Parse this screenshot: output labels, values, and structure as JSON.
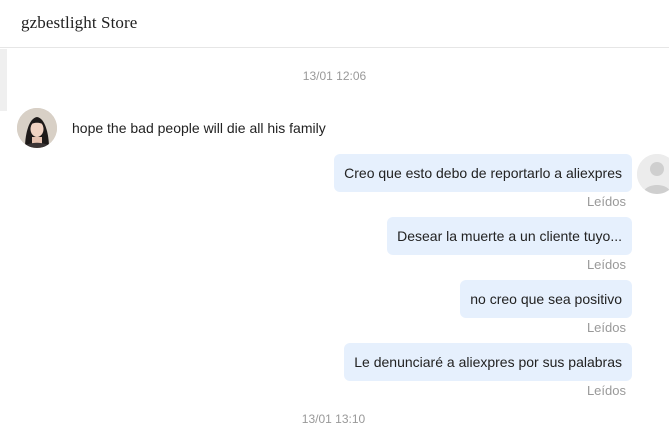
{
  "header": {
    "store_name": "gzbestlight Store"
  },
  "chat": {
    "timestamps": [
      "13/01 12:06",
      "13/01 13:10"
    ],
    "incoming": [
      {
        "text": "hope the bad people will die all his family"
      }
    ],
    "outgoing": [
      {
        "text": "Creo que esto debo de reportarlo a aliexpres",
        "status": "Leídos"
      },
      {
        "text": "Desear la muerte a un cliente tuyo...",
        "status": "Leídos"
      },
      {
        "text": "no creo que sea positivo",
        "status": "Leídos"
      },
      {
        "text": "Le denunciaré a aliexpres por sus palabras",
        "status": "Leídos"
      }
    ]
  },
  "colors": {
    "outgoing_bubble": "#e6f0fd",
    "muted_text": "#999999",
    "primary_text": "#222222",
    "header_border": "#e6e6e6"
  },
  "icons": {
    "seller_avatar": "seller-avatar-photo",
    "user_avatar": "default-user-avatar-icon"
  }
}
